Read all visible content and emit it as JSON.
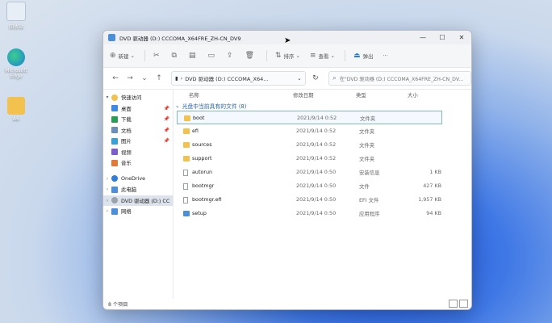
{
  "desktop": {
    "icons": [
      {
        "label": "回收站"
      },
      {
        "label": "Microsoft Edge"
      },
      {
        "label": "A6"
      }
    ]
  },
  "window": {
    "title": "DVD 驱动器 (D:) CCCOMA_X64FRE_ZH-CN_DV9",
    "controls": {
      "minimize": "—",
      "maximize": "☐",
      "close": "✕"
    }
  },
  "toolbar": {
    "new": "新建",
    "sort": "排序",
    "view": "查看",
    "eject": "弹出",
    "more": "···"
  },
  "address": {
    "path": "DVD 驱动器 (D:) CCCOMA_X64...",
    "search_placeholder": "在\"DVD 驱动器 (D:) CCCOMA_X64FRE_ZH-CN_DV..."
  },
  "sidebar": {
    "items": [
      {
        "label": "快速访问",
        "chev": "▾"
      },
      {
        "label": "桌面"
      },
      {
        "label": "下载"
      },
      {
        "label": "文档"
      },
      {
        "label": "图片"
      },
      {
        "label": "视频"
      },
      {
        "label": "音乐"
      },
      {
        "label": "OneDrive",
        "chev": "›"
      },
      {
        "label": "此电脑",
        "chev": "›"
      },
      {
        "label": "DVD 驱动器 (D:) CC",
        "chev": "›"
      },
      {
        "label": "网络",
        "chev": "›"
      }
    ]
  },
  "columns": {
    "name": "名称",
    "modified": "修改日期",
    "type": "类型",
    "size": "大小"
  },
  "group": {
    "label": "光盘中当前具有的文件 (8)"
  },
  "files": [
    {
      "name": "boot",
      "modified": "2021/9/14 0:52",
      "type": "文件夹",
      "size": ""
    },
    {
      "name": "efi",
      "modified": "2021/9/14 0:52",
      "type": "文件夹",
      "size": ""
    },
    {
      "name": "sources",
      "modified": "2021/9/14 0:52",
      "type": "文件夹",
      "size": ""
    },
    {
      "name": "support",
      "modified": "2021/9/14 0:52",
      "type": "文件夹",
      "size": ""
    },
    {
      "name": "autorun",
      "modified": "2021/9/14 0:50",
      "type": "安装信息",
      "size": "1 KB"
    },
    {
      "name": "bootmgr",
      "modified": "2021/9/14 0:50",
      "type": "文件",
      "size": "427 KB"
    },
    {
      "name": "bootmgr.efi",
      "modified": "2021/9/14 0:50",
      "type": "EFI 文件",
      "size": "1,957 KB"
    },
    {
      "name": "setup",
      "modified": "2021/9/14 0:50",
      "type": "应用程序",
      "size": "94 KB"
    }
  ],
  "status": {
    "count": "8 个项目"
  }
}
